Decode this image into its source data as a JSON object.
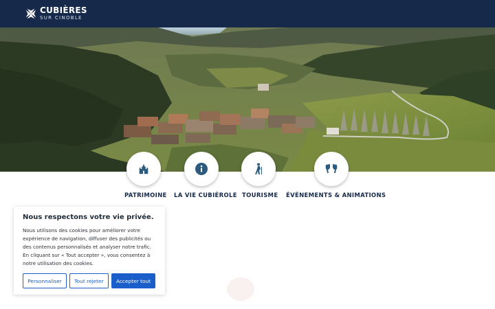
{
  "header": {
    "logo_title": "CUBIÈRES",
    "logo_subtitle": "SUR CINOBLE",
    "logo_icon": "maltese-cross-icon",
    "background_color": "#16294a"
  },
  "categories": [
    {
      "label": "PATRIMOINE",
      "icon": "castle-icon"
    },
    {
      "label": "LA VIE CUBIÉROLE",
      "icon": "info-icon"
    },
    {
      "label": "TOURISME",
      "icon": "hiker-icon"
    },
    {
      "label": "ÉVÉNEMENTS & ANIMATIONS",
      "icon": "toast-glasses-icon"
    }
  ],
  "cookie_banner": {
    "title": "Nous respectons votre vie privée.",
    "text": "Nous utilisons des cookies pour améliorer votre expérience de navigation, diffuser des publicités ou des contenus personnalisés et analyser notre trafic. En cliquant sur « Tout accepter », vous consentez à notre utilisation des cookies.",
    "buttons": {
      "customize": "Personnaliser",
      "reject": "Tout rejeter",
      "accept": "Accepter tout"
    },
    "accent_color": "#1a5fc9"
  },
  "colors": {
    "navy": "#16294a",
    "icon_blue": "#2d5b7e"
  }
}
